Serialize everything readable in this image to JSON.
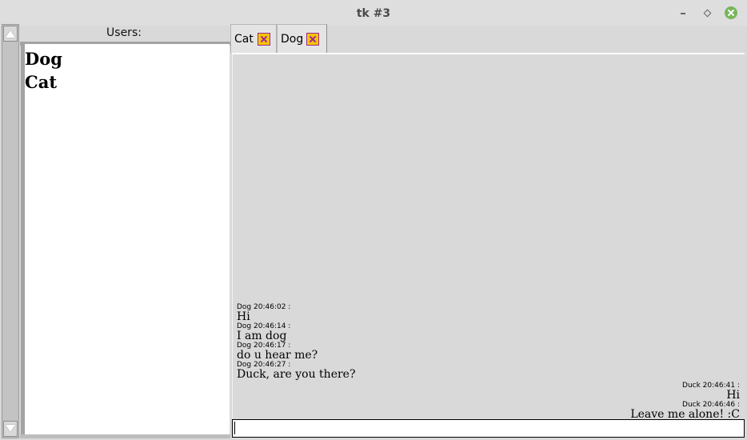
{
  "window": {
    "title": "tk #3"
  },
  "users": {
    "label": "Users:",
    "items": [
      {
        "name": "Dog"
      },
      {
        "name": "Cat"
      }
    ]
  },
  "tabs": [
    {
      "label": "Cat",
      "close_icon": "close-x-icon"
    },
    {
      "label": "Dog",
      "close_icon": "close-x-icon",
      "selected": true
    }
  ],
  "chat": {
    "messages": [
      {
        "meta": "Dog 20:46:02 :",
        "text": "Hi",
        "align": "left"
      },
      {
        "meta": "Dog 20:46:14 :",
        "text": "I am dog",
        "align": "left"
      },
      {
        "meta": "Dog 20:46:17 :",
        "text": "do u hear me?",
        "align": "left"
      },
      {
        "meta": "Dog 20:46:27 :",
        "text": "Duck, are you there?",
        "align": "left"
      },
      {
        "meta": "Duck 20:46:41 :",
        "text": "Hi",
        "align": "right"
      },
      {
        "meta": "Duck 20:46:46 :",
        "text": "Leave me alone! :C",
        "align": "right"
      }
    ]
  },
  "input": {
    "value": ""
  }
}
